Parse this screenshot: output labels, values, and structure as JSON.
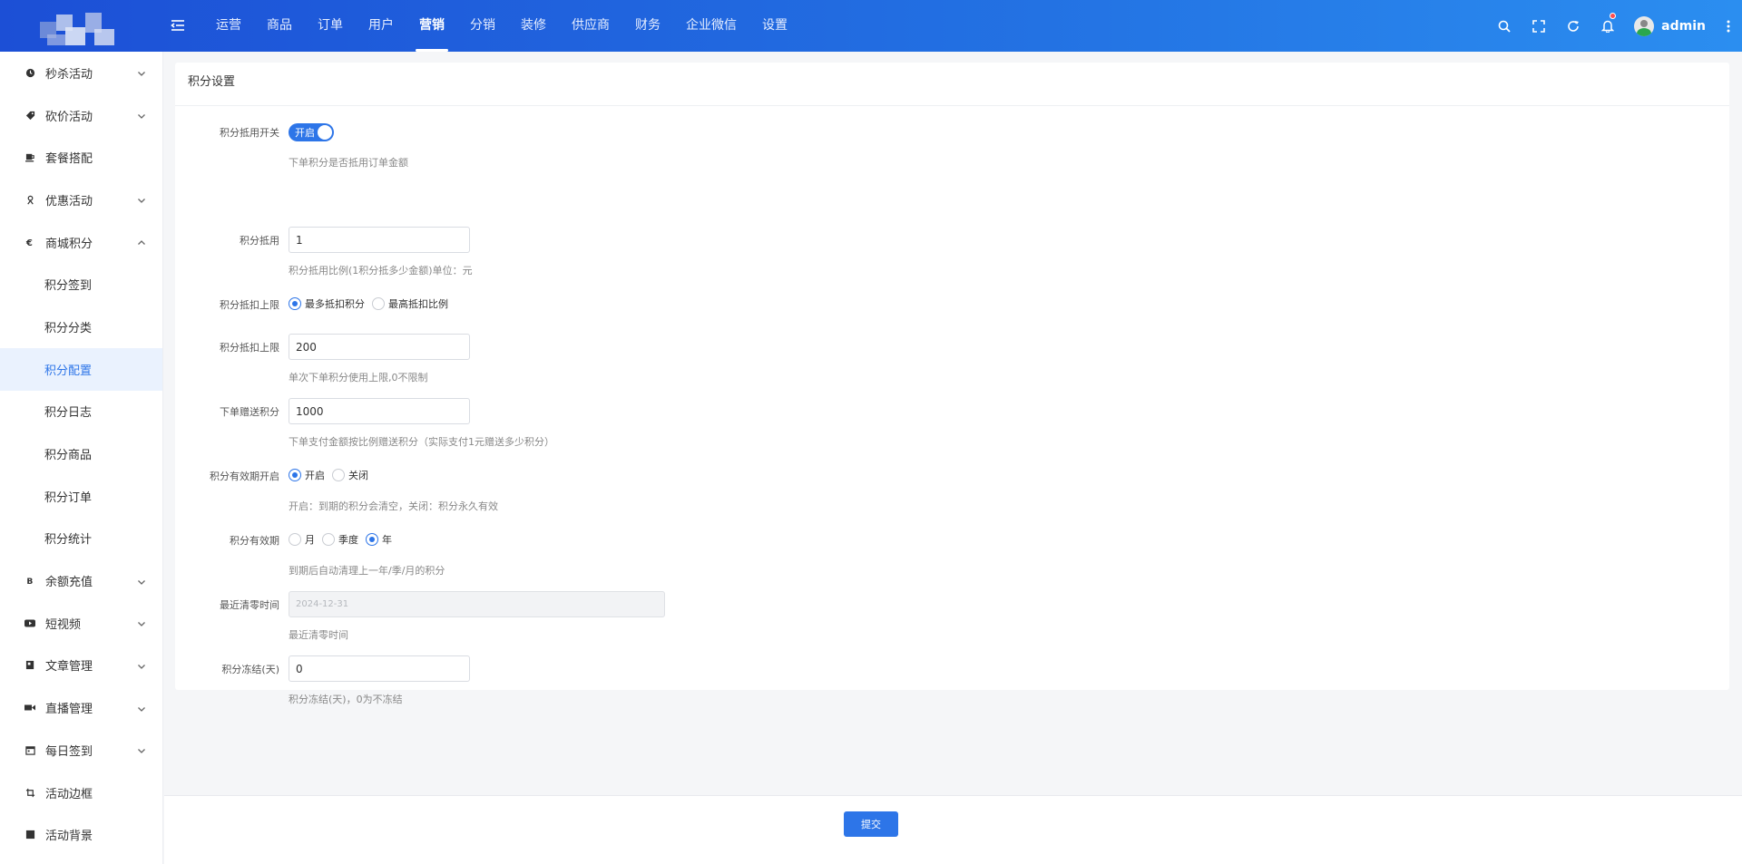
{
  "header": {
    "nav": [
      "运营",
      "商品",
      "订单",
      "用户",
      "营销",
      "分销",
      "装修",
      "供应商",
      "财务",
      "企业微信",
      "设置"
    ],
    "active_nav": "营销",
    "user": "admin"
  },
  "sidebar": {
    "items": [
      {
        "label": "秒杀活动",
        "icon": "clock-icon",
        "has_chevron": true,
        "expanded": false
      },
      {
        "label": "砍价活动",
        "icon": "tag-icon",
        "has_chevron": true,
        "expanded": false
      },
      {
        "label": "套餐搭配",
        "icon": "cup-icon",
        "has_chevron": false
      },
      {
        "label": "优惠活动",
        "icon": "gift-icon",
        "has_chevron": true,
        "expanded": false
      },
      {
        "label": "商城积分",
        "icon": "euro-icon",
        "has_chevron": true,
        "expanded": true
      },
      {
        "label": "积分签到",
        "sub": true
      },
      {
        "label": "积分分类",
        "sub": true
      },
      {
        "label": "积分配置",
        "sub": true,
        "active": true
      },
      {
        "label": "积分日志",
        "sub": true
      },
      {
        "label": "积分商品",
        "sub": true
      },
      {
        "label": "积分订单",
        "sub": true
      },
      {
        "label": "积分统计",
        "sub": true
      },
      {
        "label": "余额充值",
        "icon": "bitcoin-icon",
        "has_chevron": true,
        "expanded": false
      },
      {
        "label": "短视频",
        "icon": "video-icon",
        "has_chevron": true,
        "expanded": false
      },
      {
        "label": "文章管理",
        "icon": "article-icon",
        "has_chevron": true,
        "expanded": false
      },
      {
        "label": "直播管理",
        "icon": "camera-icon",
        "has_chevron": true,
        "expanded": false
      },
      {
        "label": "每日签到",
        "icon": "calendar-icon",
        "has_chevron": true,
        "expanded": false
      },
      {
        "label": "活动边框",
        "icon": "crop-icon",
        "has_chevron": false
      },
      {
        "label": "活动背景",
        "icon": "square-icon",
        "has_chevron": false
      }
    ]
  },
  "panel": {
    "title": "积分设置"
  },
  "form": {
    "switch": {
      "label": "积分抵用开关",
      "text": "开启",
      "on": true,
      "help": "下单积分是否抵用订单金额"
    },
    "deduct": {
      "label": "积分抵用",
      "value": "1",
      "help": "积分抵用比例(1积分抵多少金额)单位：元"
    },
    "limit_type": {
      "label": "积分抵扣上限",
      "options": [
        "最多抵扣积分",
        "最高抵扣比例"
      ],
      "selected": 0
    },
    "limit_value": {
      "label": "积分抵扣上限",
      "value": "200",
      "help": "单次下单积分使用上限,0不限制"
    },
    "gift": {
      "label": "下单赠送积分",
      "value": "1000",
      "help": "下单支付金额按比例赠送积分（实际支付1元赠送多少积分）"
    },
    "expire_on": {
      "label": "积分有效期开启",
      "options": [
        "开启",
        "关闭"
      ],
      "selected": 0,
      "help": "开启：到期的积分会清空，关闭：积分永久有效"
    },
    "expire_period": {
      "label": "积分有效期",
      "options": [
        "月",
        "季度",
        "年"
      ],
      "selected": 2,
      "help": "到期后自动清理上一年/季/月的积分"
    },
    "last_clear": {
      "label": "最近清零时间",
      "value": "2024-12-31",
      "help": "最近清零时间"
    },
    "freeze": {
      "label": "积分冻结(天)",
      "value": "0",
      "help": "积分冻结(天)，0为不冻结"
    }
  },
  "footer": {
    "submit": "提交"
  },
  "colors": {
    "primary": "#2d75e8",
    "header_start": "#1c4fd6",
    "header_end": "#2b8ef0"
  }
}
